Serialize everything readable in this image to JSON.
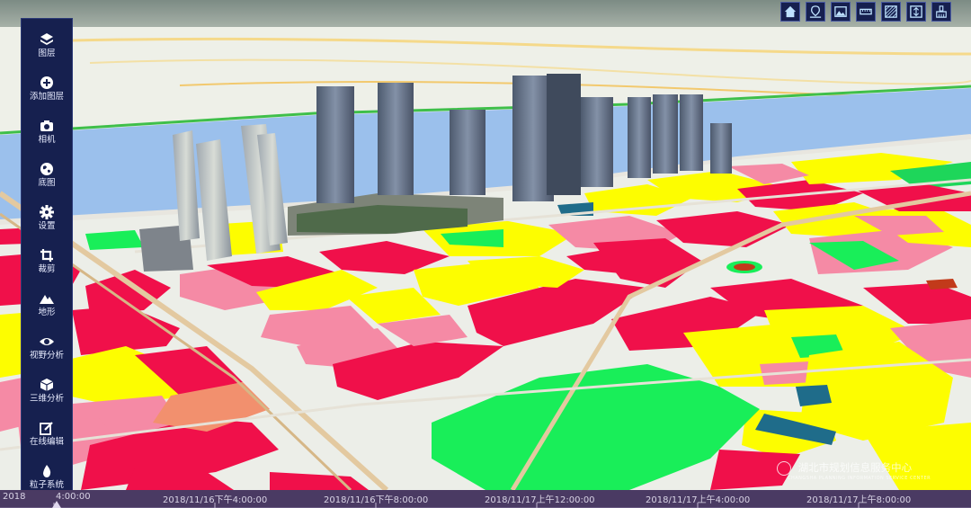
{
  "sidebar": {
    "items": [
      {
        "label": "图层",
        "icon": "layers-icon"
      },
      {
        "label": "添加图层",
        "icon": "add-circle-icon"
      },
      {
        "label": "相机",
        "icon": "camera-icon"
      },
      {
        "label": "底图",
        "icon": "globe-icon"
      },
      {
        "label": "设置",
        "icon": "gear-icon"
      },
      {
        "label": "裁剪",
        "icon": "crop-icon"
      },
      {
        "label": "地形",
        "icon": "mountain-icon"
      },
      {
        "label": "视野分析",
        "icon": "eye-icon"
      },
      {
        "label": "三维分析",
        "icon": "cube-icon"
      },
      {
        "label": "在线编辑",
        "icon": "edit-icon"
      },
      {
        "label": "粒子系统",
        "icon": "flame-icon"
      }
    ]
  },
  "toolbar": {
    "buttons": [
      "home-icon",
      "map-pin-icon",
      "picture-icon",
      "ruler-icon",
      "hatch-area-icon",
      "height-measure-icon",
      "clear-brush-icon"
    ]
  },
  "timeline": {
    "labels": [
      "2018",
      "4:00:00",
      "2018/11/16下午4:00:00",
      "2018/11/16下午8:00:00",
      "2018/11/17上午12:00:00",
      "2018/11/17上午4:00:00",
      "2018/11/17上午8:00:00"
    ]
  },
  "watermark": {
    "text": "湖北市规划信息服务中心",
    "subtext": "CHANGSHA PLANNING INFORMATION SERVICE CENTER"
  },
  "colors": {
    "sidebar_bg": "#16204f",
    "timeline_bg": "#4a3a63",
    "zone_red": "#f0104a",
    "zone_yellow": "#fdfd00",
    "zone_green": "#19ee59",
    "zone_pink": "#f58aa5",
    "river": "#9bc0ec"
  }
}
